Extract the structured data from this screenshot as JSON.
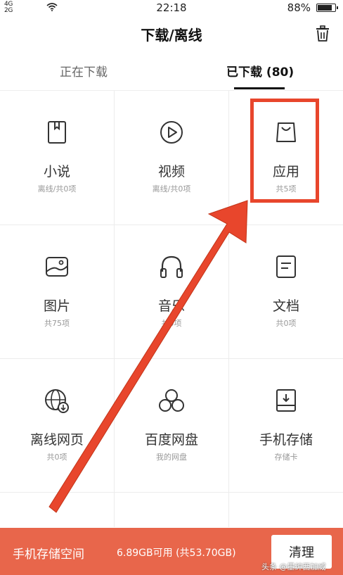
{
  "status_bar": {
    "network_left_top": "4G",
    "network_left_bottom": "2G",
    "time": "22:18",
    "battery_pct": "88%",
    "battery_level": 0.88
  },
  "header": {
    "title": "下载/离线",
    "trash_icon": "trash-icon"
  },
  "tabs": [
    {
      "label": "正在下载",
      "active": false
    },
    {
      "label": "已下载 (80)",
      "active": true
    }
  ],
  "grid": [
    {
      "name": "小说",
      "sub": "离线/共0项",
      "icon": "book-icon"
    },
    {
      "name": "视频",
      "sub": "离线/共0项",
      "icon": "play-icon"
    },
    {
      "name": "应用",
      "sub": "共5项",
      "icon": "bag-icon"
    },
    {
      "name": "图片",
      "sub": "共75项",
      "icon": "image-icon"
    },
    {
      "name": "音乐",
      "sub": "共0项",
      "icon": "headphones-icon"
    },
    {
      "name": "文档",
      "sub": "共0项",
      "icon": "document-icon"
    },
    {
      "name": "离线网页",
      "sub": "共0项",
      "icon": "globe-download-icon"
    },
    {
      "name": "百度网盘",
      "sub": "我的网盘",
      "icon": "cloud-circles-icon"
    },
    {
      "name": "手机存储",
      "sub": "存储卡",
      "icon": "storage-icon"
    }
  ],
  "bottom_bar": {
    "label": "手机存储空间",
    "space": "6.89GB可用 (共53.70GB)",
    "clear_button": "清理"
  },
  "watermark": "头条 @墨绅西加威",
  "colors": {
    "accent": "#e8664b",
    "highlight": "#e8462c"
  }
}
